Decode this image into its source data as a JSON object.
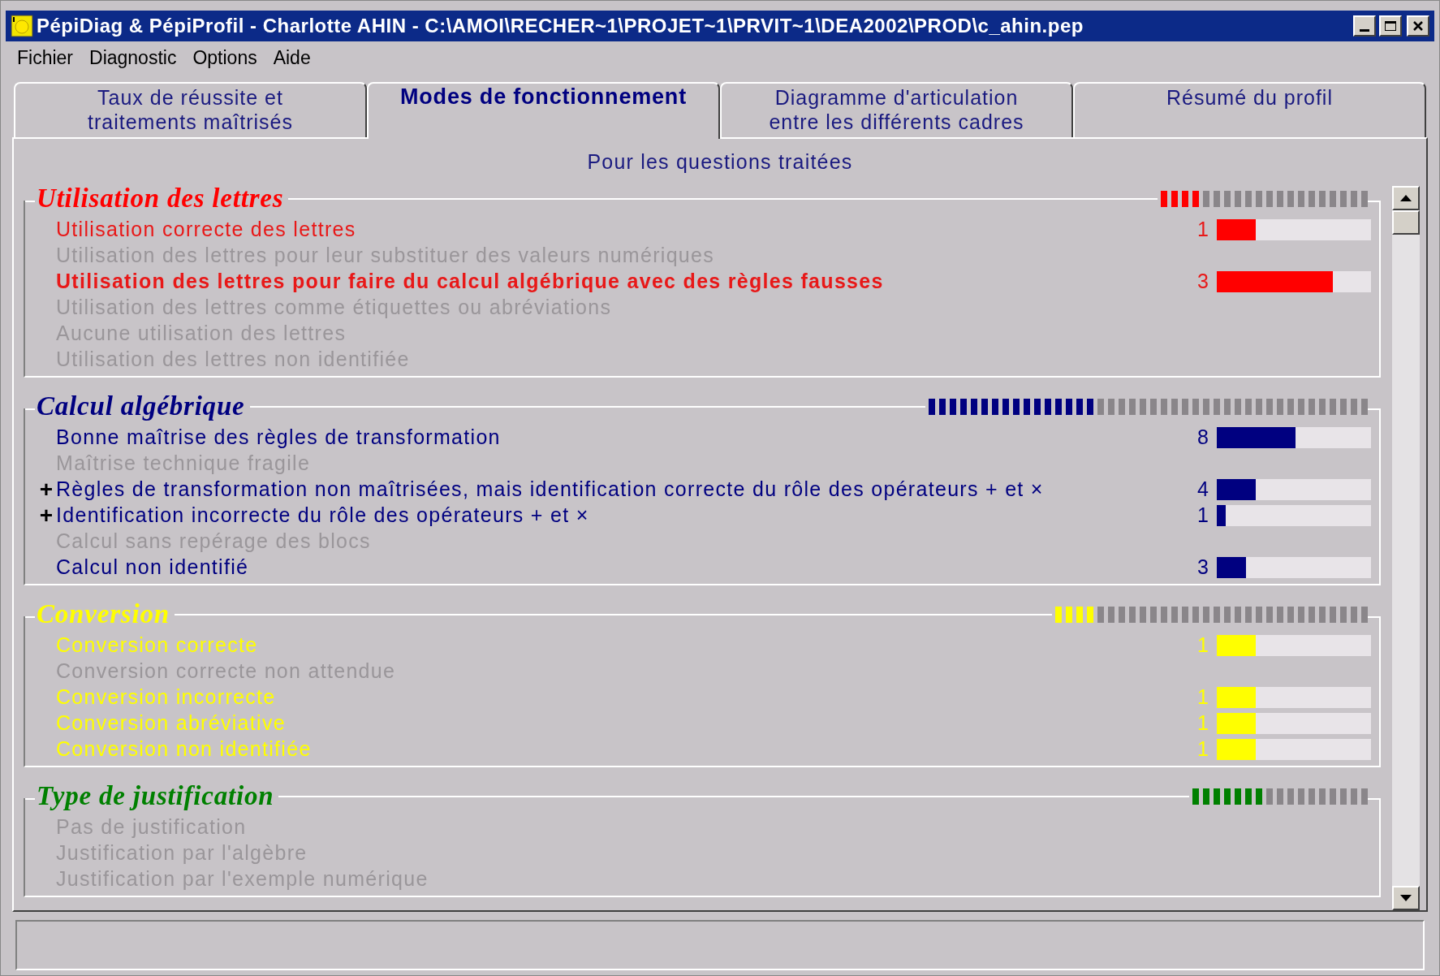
{
  "window": {
    "title": "PépiDiag & PépiProfil - Charlotte AHIN - C:\\AMOI\\RECHER~1\\PROJET~1\\PRVIT~1\\DEA2002\\PROD\\c_ahin.pep"
  },
  "menu": [
    "Fichier",
    "Diagnostic",
    "Options",
    "Aide"
  ],
  "tabs": [
    {
      "label": "Taux de réussite et\ntraitements maîtrisés",
      "selected": false
    },
    {
      "label": "Modes de fonctionnement",
      "selected": true
    },
    {
      "label": "Diagramme d'articulation\nentre les différents cadres",
      "selected": false
    },
    {
      "label": "Résumé du profil",
      "selected": false
    }
  ],
  "subtitle": "Pour les questions traitées",
  "sections": [
    {
      "title": "Utilisation des lettres",
      "color": "#ff0000",
      "level": 0.2,
      "items": [
        {
          "label": "Utilisation correcte des lettres",
          "enabled": true,
          "bold": false,
          "count": "1",
          "level": 0.25
        },
        {
          "label": "Utilisation des lettres pour leur substituer des valeurs numériques",
          "enabled": false,
          "bold": false
        },
        {
          "label": "Utilisation des lettres pour faire du calcul algébrique avec des règles fausses",
          "enabled": true,
          "bold": true,
          "count": "3",
          "level": 0.75
        },
        {
          "label": "Utilisation des lettres comme étiquettes ou abréviations",
          "enabled": false,
          "bold": false
        },
        {
          "label": "Aucune utilisation des lettres",
          "enabled": false,
          "bold": false
        },
        {
          "label": "Utilisation des lettres non identifiée",
          "enabled": false,
          "bold": false
        }
      ]
    },
    {
      "title": "Calcul algébrique",
      "color": "#000080",
      "level": 0.38,
      "items": [
        {
          "label": "Bonne maîtrise des règles de transformation",
          "enabled": true,
          "bold": false,
          "count": "8",
          "level": 0.51
        },
        {
          "label": "Maîtrise technique fragile",
          "enabled": false,
          "bold": false
        },
        {
          "marker": "+",
          "label": "Règles de transformation non maîtrisées, mais identification correcte du rôle des opérateurs + et ×",
          "enabled": true,
          "bold": false,
          "count": "4",
          "level": 0.25
        },
        {
          "marker": "+",
          "label": "Identification incorrecte du rôle des opérateurs + et ×",
          "enabled": true,
          "bold": false,
          "count": "1",
          "level": 0.06
        },
        {
          "label": "Calcul sans repérage des blocs",
          "enabled": false,
          "bold": false
        },
        {
          "label": "Calcul non identifié",
          "enabled": true,
          "bold": false,
          "count": "3",
          "level": 0.19
        }
      ]
    },
    {
      "title": "Conversion",
      "color": "#ffff00",
      "level": 0.13,
      "items": [
        {
          "label": "Conversion correcte",
          "enabled": true,
          "bold": false,
          "count": "1",
          "level": 0.25
        },
        {
          "label": "Conversion correcte non attendue",
          "enabled": false,
          "bold": false
        },
        {
          "label": "Conversion incorrecte",
          "enabled": true,
          "bold": false,
          "count": "1",
          "level": 0.25
        },
        {
          "label": "Conversion abréviative",
          "enabled": true,
          "bold": false,
          "count": "1",
          "level": 0.25
        },
        {
          "label": "Conversion non identifiée",
          "enabled": true,
          "bold": false,
          "count": "1",
          "level": 0.25
        }
      ]
    },
    {
      "title": "Type de justification",
      "color": "#008000",
      "level": 0.41,
      "items": [
        {
          "label": "Pas de justification",
          "enabled": false,
          "bold": false
        },
        {
          "label": "Justification par l'algèbre",
          "enabled": false,
          "bold": false
        },
        {
          "label": "Justification par l'exemple numérique",
          "enabled": false,
          "bold": false
        }
      ]
    }
  ]
}
